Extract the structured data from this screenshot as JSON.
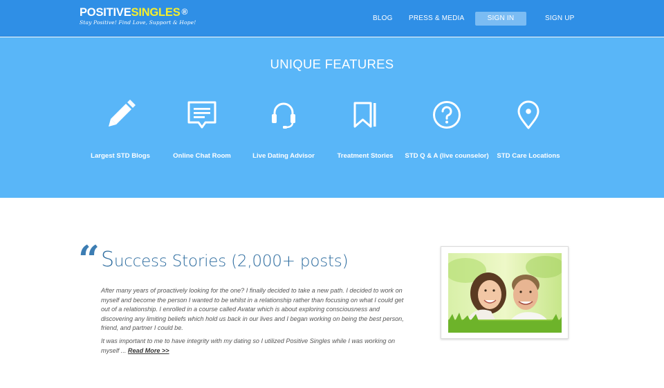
{
  "header": {
    "logo": {
      "part1": "POSITIVE",
      "part2": "SINGLES",
      "registered": "®",
      "tagline": "Stay Positive! Find Love, Support & Hope!"
    },
    "nav": {
      "blog": "BLOG",
      "press": "PRESS & MEDIA",
      "signin": "SIGN IN",
      "signup": "SIGN UP"
    }
  },
  "features": {
    "title": "UNIQUE FEATURES",
    "items": [
      {
        "label": "Largest STD Blogs",
        "icon": "pencil-icon"
      },
      {
        "label": "Online Chat Room",
        "icon": "chat-bubble-icon"
      },
      {
        "label": "Live Dating Advisor",
        "icon": "headset-icon"
      },
      {
        "label": "Treatment Stories",
        "icon": "bookmark-book-icon"
      },
      {
        "label": "STD Q & A (live counselor)",
        "icon": "question-circle-icon"
      },
      {
        "label": "STD Care Locations",
        "icon": "map-pin-icon"
      }
    ]
  },
  "stories": {
    "quote_mark": "“",
    "title_first_letter": "S",
    "title_rest": "uccess Stories (2,000+ posts)",
    "paragraph1": "After many years of proactively looking for the one? I finally decided to take a new path. I decided to work on myself and become the person I wanted to be whilst in a relationship rather than focusing on what I could get out of a relationship. I enrolled in a course called Avatar which is about exploring consciousness and discovering any limiting beliefs which hold us back in our lives and I began working on being the best person, friend, and partner I could be.",
    "paragraph2": "It was important to me to have integrity with my dating so I utilized Positive Singles while I was working on myself ...",
    "read_more": "Read More >>",
    "photo_icon": "couple-photo"
  },
  "colors": {
    "header_bg": "#2f8fe6",
    "features_bg": "#59b6f8",
    "logo_yellow": "#f5ee2b",
    "signin_bg": "#7bbcf3",
    "title_blue": "#2d6c9f"
  }
}
